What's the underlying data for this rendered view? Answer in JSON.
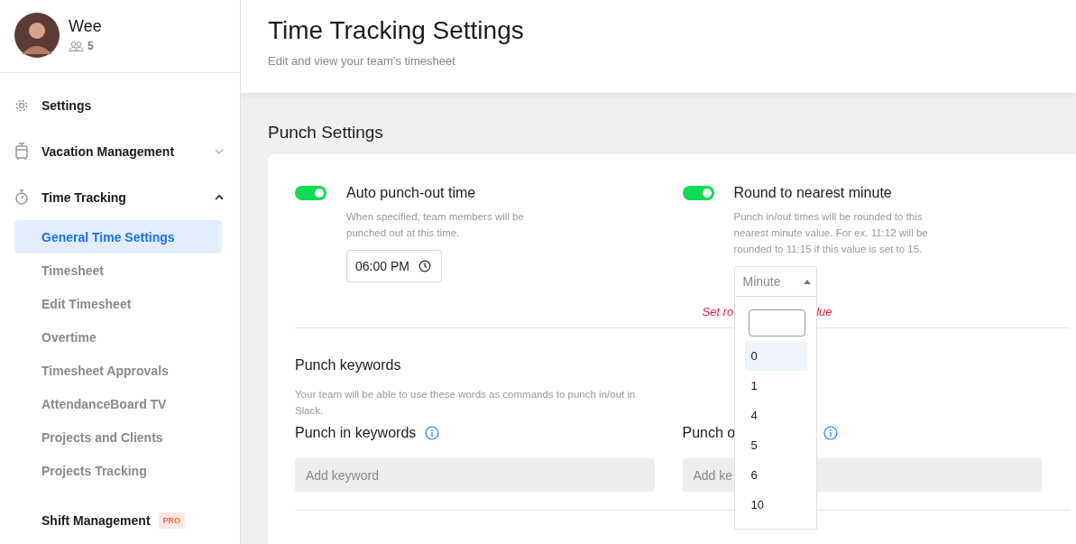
{
  "user": {
    "name": "Wee",
    "team_count": "5"
  },
  "sidebar": {
    "items": [
      {
        "kind": "link",
        "label": "Settings"
      },
      {
        "kind": "group",
        "label": "Vacation Management",
        "expanded": false
      },
      {
        "kind": "group",
        "label": "Time Tracking",
        "expanded": true,
        "children": [
          {
            "label": "General Time Settings",
            "selected": true
          },
          {
            "label": "Timesheet",
            "selected": false
          },
          {
            "label": "Edit Timesheet",
            "selected": false
          },
          {
            "label": "Overtime",
            "selected": false
          },
          {
            "label": "Timesheet Approvals",
            "selected": false
          },
          {
            "label": "AttendanceBoard TV",
            "selected": false
          },
          {
            "label": "Projects and Clients",
            "selected": false
          },
          {
            "label": "Projects Tracking",
            "selected": false
          }
        ]
      },
      {
        "kind": "link",
        "label": "Shift Management",
        "badge": "PRO"
      }
    ]
  },
  "header": {
    "title": "Time Tracking Settings",
    "subtitle": "Edit and view your team’s timesheet"
  },
  "section_title": "Punch Settings",
  "settings": [
    {
      "label": "Auto punch-out time",
      "on": true,
      "description": "When specified, team members will be punched out at this time.",
      "control": {
        "kind": "time",
        "value": "06:00 PM"
      }
    },
    {
      "label": "Round to nearest minute",
      "on": true,
      "description": "Punch in/out times will be rounded to this nearest minute value. For ex. 11:12 will be rounded to 11:15 if this value is set to 15.",
      "control": {
        "kind": "select",
        "placeholder": "Minute",
        "expanded": true,
        "options": [
          {
            "label": "0",
            "selected": true
          },
          {
            "label": "1",
            "selected": false
          },
          {
            "label": "4",
            "selected": false
          },
          {
            "label": "5",
            "selected": false
          },
          {
            "label": "6",
            "selected": false
          },
          {
            "label": "10",
            "selected": false
          }
        ],
        "error_parts": [
          "Set ro",
          "lue"
        ]
      }
    }
  ],
  "keywords": {
    "title": "Punch keywords",
    "description": "Your team will be able to use these words as commands to punch in/out in Slack.",
    "fields": [
      {
        "label": "Punch in keywords",
        "placeholder": "Add keyword"
      },
      {
        "label": "Punch o",
        "placeholder": "Add ke"
      }
    ]
  }
}
